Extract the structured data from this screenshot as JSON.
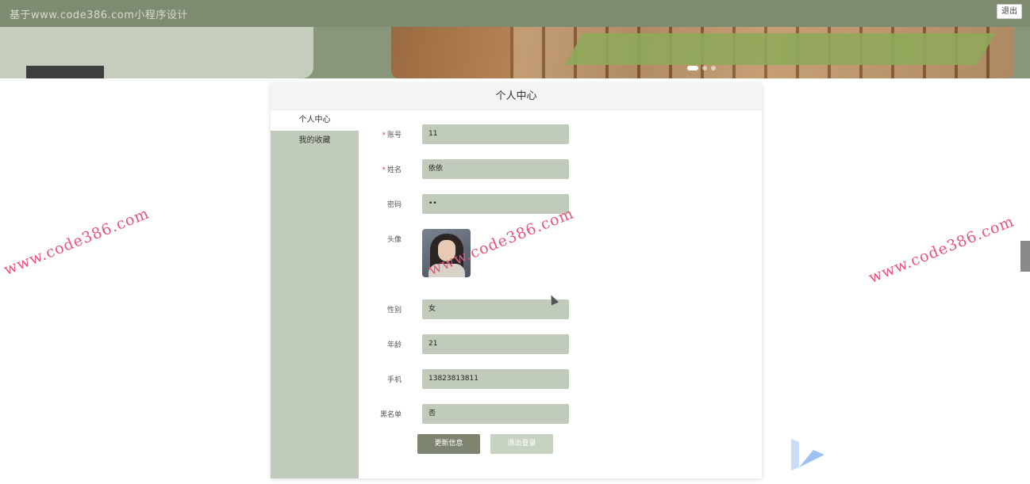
{
  "header": {
    "title": "基于www.code386.com小程序设计",
    "logout_label": "退出"
  },
  "card": {
    "title": "个人中心"
  },
  "sidebar": {
    "items": [
      {
        "label": "个人中心",
        "active": true
      },
      {
        "label": "我的收藏",
        "active": false
      }
    ]
  },
  "form": {
    "account": {
      "label": "账号",
      "value": "11",
      "required": true
    },
    "name": {
      "label": "姓名",
      "value": "依依",
      "required": true
    },
    "password": {
      "label": "密码",
      "value": "••"
    },
    "avatar": {
      "label": "头像"
    },
    "gender": {
      "label": "性别",
      "value": "女"
    },
    "age": {
      "label": "年龄",
      "value": "21"
    },
    "phone": {
      "label": "手机",
      "value": "13823813811"
    },
    "blacklist": {
      "label": "黑名单",
      "value": "否"
    }
  },
  "actions": {
    "update_label": "更新信息",
    "logout_label": "退出登录"
  },
  "watermark": "www.code386.com",
  "colors": {
    "topbar": "#7f8b70",
    "sage": "#c1cbbb",
    "button_dark": "#7d8470",
    "watermark": "#e8557a"
  }
}
